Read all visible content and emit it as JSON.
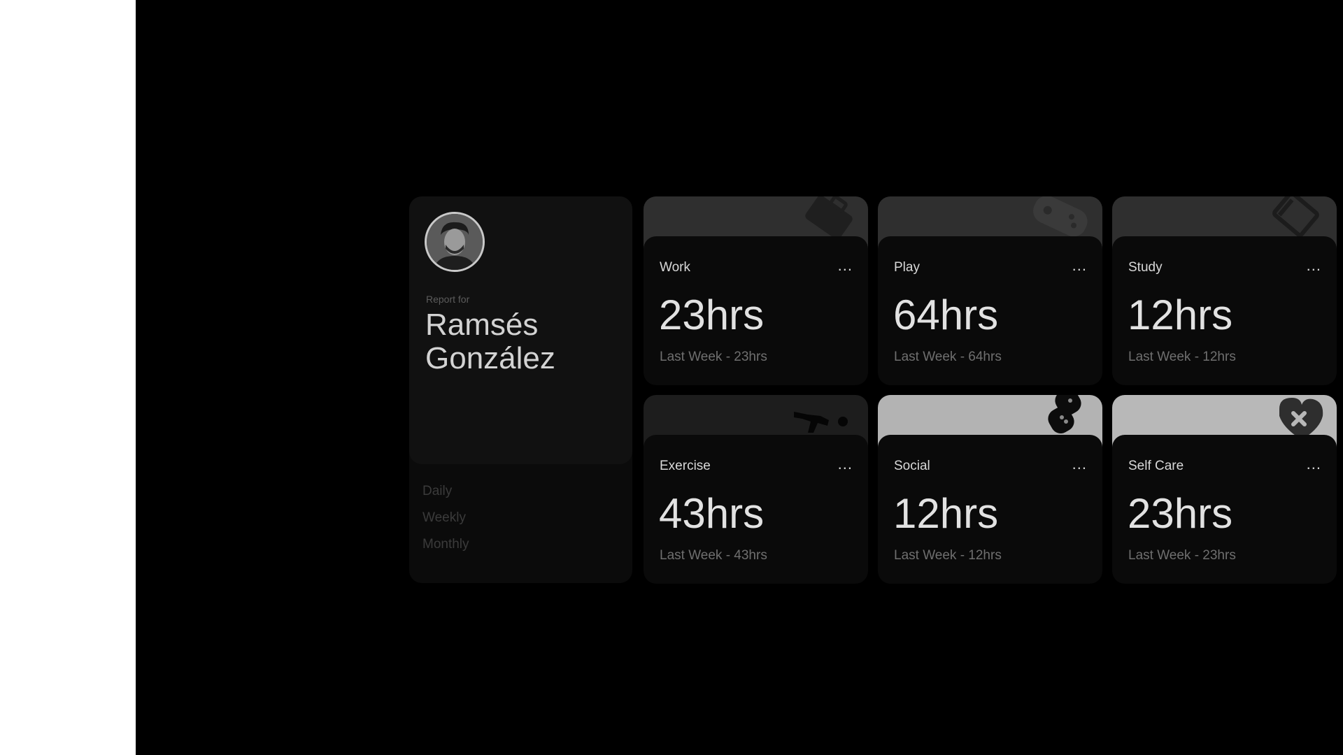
{
  "profile": {
    "report_label": "Report for",
    "name": "Ramsés González",
    "periods": [
      "Daily",
      "Weekly",
      "Monthly"
    ]
  },
  "cards": [
    {
      "title": "Work",
      "hours": "23hrs",
      "last": "Last Week - 23hrs",
      "band_color": "#2f2f2f",
      "icon": "briefcase-icon"
    },
    {
      "title": "Play",
      "hours": "64hrs",
      "last": "Last Week - 64hrs",
      "band_color": "#2f2f2f",
      "icon": "gamepad-icon"
    },
    {
      "title": "Study",
      "hours": "12hrs",
      "last": "Last Week - 12hrs",
      "band_color": "#2f2f2f",
      "icon": "book-icon"
    },
    {
      "title": "Exercise",
      "hours": "43hrs",
      "last": "Last Week - 43hrs",
      "band_color": "#1d1d1d",
      "icon": "running-icon"
    },
    {
      "title": "Social",
      "hours": "12hrs",
      "last": "Last Week - 12hrs",
      "band_color": "#b3b3b3",
      "icon": "chat-bubble-icon"
    },
    {
      "title": "Self Care",
      "hours": "23hrs",
      "last": "Last Week - 23hrs",
      "band_color": "#b8b8b8",
      "icon": "heart-icon"
    }
  ],
  "more_label": "..."
}
